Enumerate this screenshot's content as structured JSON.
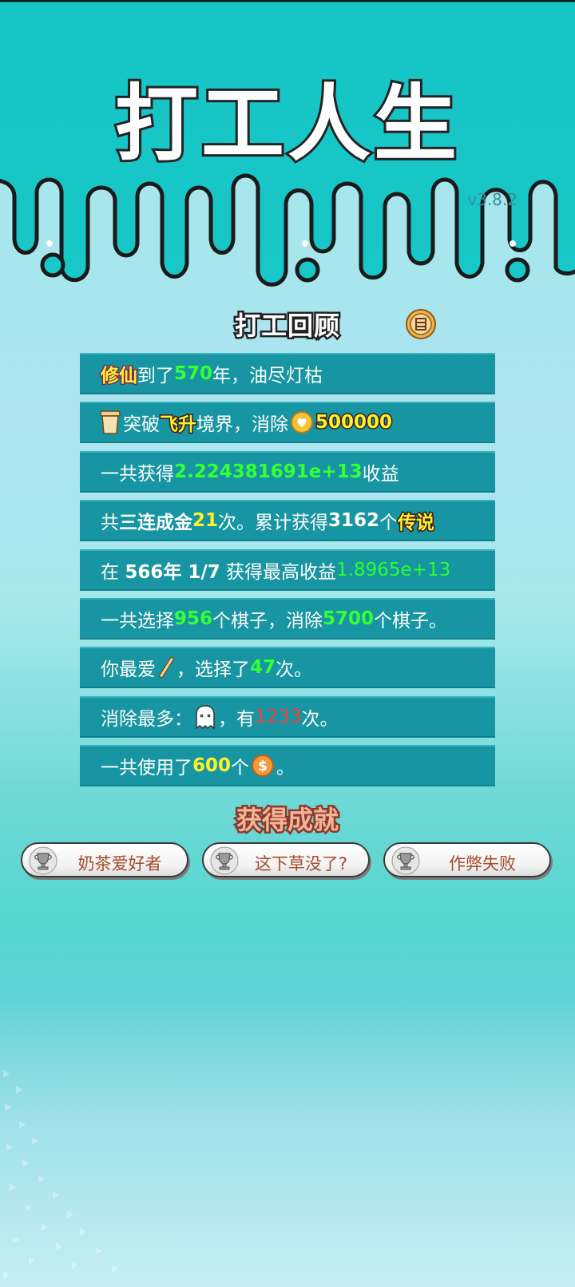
{
  "header": {
    "title": "打工人生",
    "version": "v3.8.2"
  },
  "review": {
    "title": "打工回顾",
    "share_icon": "stamp-icon",
    "rows": [
      {
        "tag": "修仙",
        "t1": "到了",
        "num": "570",
        "t2": "年，油尽灯枯"
      },
      {
        "t1": "突破",
        "tag": "飞升",
        "t2": "境界，消除",
        "num": "500000",
        "icon1": "bucket-icon",
        "icon2": "heart-coin-icon"
      },
      {
        "t1": "一共获得",
        "num": "2.224381691e+13",
        "t2": "收益"
      },
      {
        "t1": "共",
        "b1": "三连成金",
        "num": "21",
        "t2": "次。累计获得",
        "b2": "3162",
        "t3": "个",
        "tag": "传说"
      },
      {
        "t1": "在 ",
        "b1": "566年 1/7",
        "t2": " 获得最高收益",
        "num": "1.8965e+13"
      },
      {
        "t1": "一共选择",
        "num": "956",
        "t2": "个棋子，消除",
        "num2": "5700",
        "t3": "个棋子。"
      },
      {
        "t1": "你最爱",
        "t2": "，选择了",
        "num": "47",
        "t3": "次。",
        "icon": "stick-icon"
      },
      {
        "t1": "消除最多：",
        "t2": "，有",
        "num": "1233",
        "t3": "次。",
        "icon": "ghost-icon"
      },
      {
        "t1": "一共使用了",
        "num": "600",
        "t2": "个",
        "t3": "。",
        "icon": "dollar-coin-icon"
      }
    ]
  },
  "achievements": {
    "title": "获得成就",
    "items": [
      {
        "label": "奶茶爱好者",
        "icon": "trophy-icon"
      },
      {
        "label": "这下草没了?",
        "icon": "trophy-icon"
      },
      {
        "label": "作弊失败",
        "icon": "trophy-icon"
      }
    ]
  },
  "colors": {
    "row_bg": "#1795a2",
    "highlight_green": "#35ff35",
    "highlight_yellow": "#fff227",
    "highlight_red": "#ff3b3b",
    "header_teal": "#18c5c6"
  }
}
